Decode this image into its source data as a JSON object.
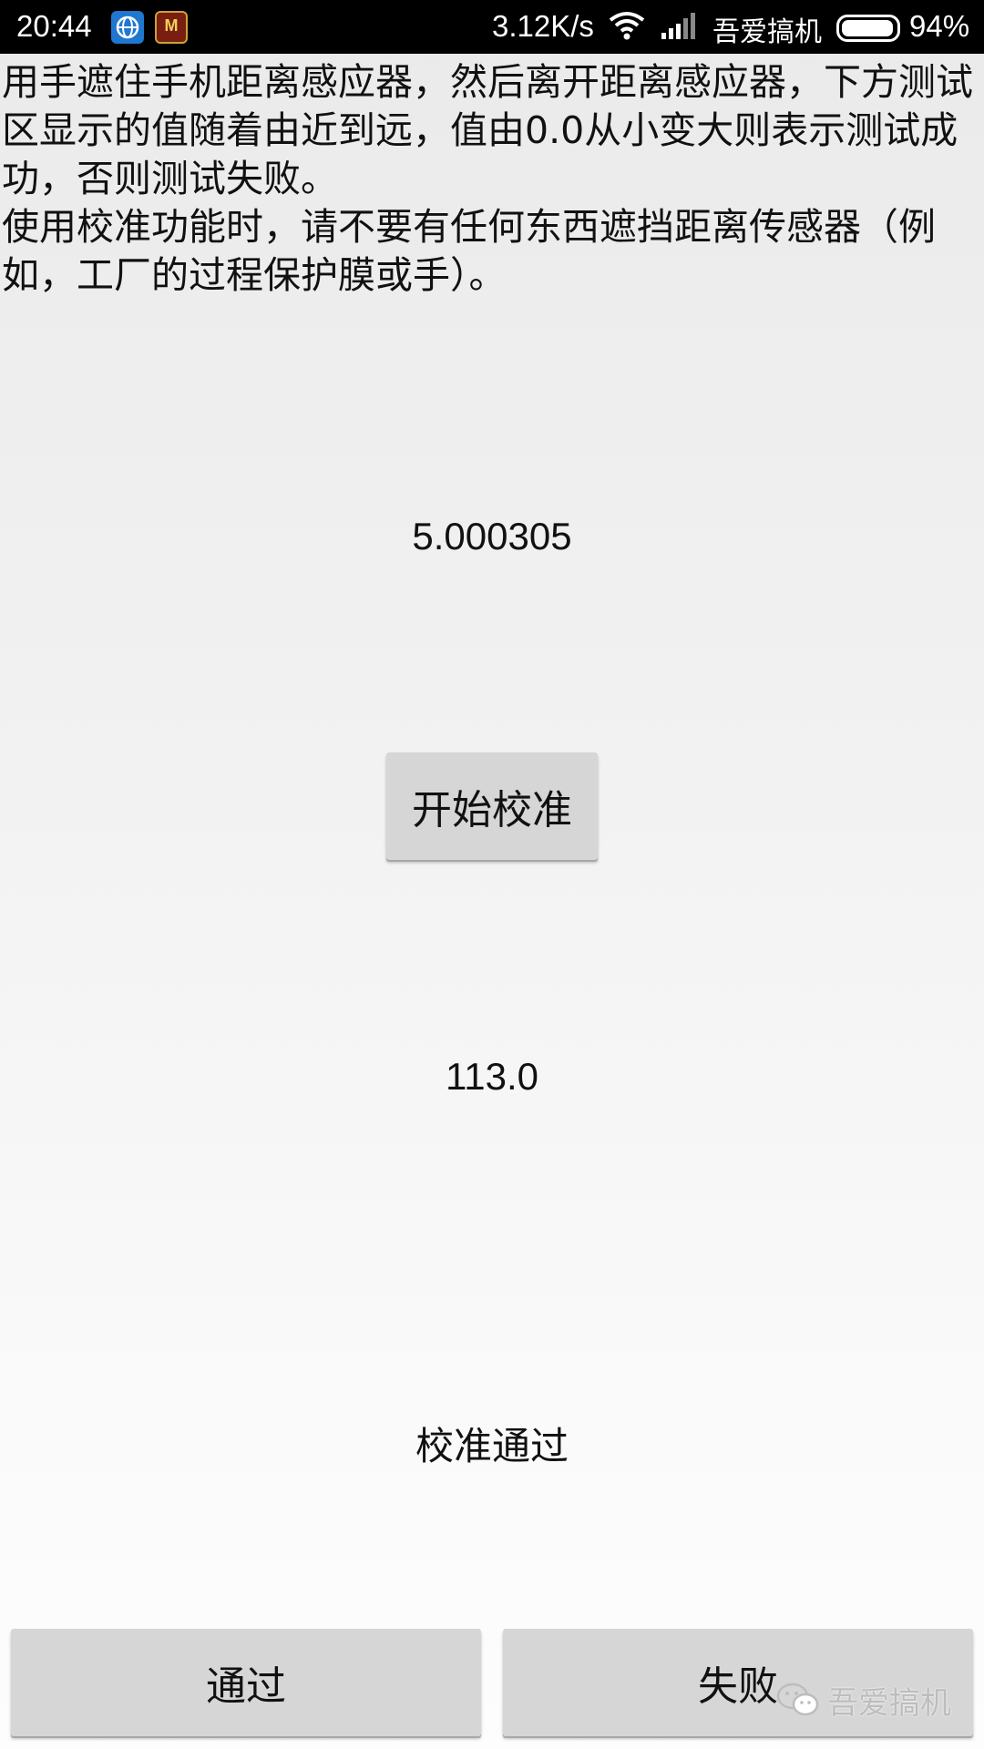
{
  "status_bar": {
    "time": "20:44",
    "net_speed": "3.12K/s",
    "carrier": "吾爱搞机",
    "battery": "94%",
    "icons": [
      "globe-app-icon",
      "game-app-icon",
      "wifi-icon",
      "signal-icon",
      "battery-icon"
    ]
  },
  "instructions": {
    "paragraph1": "用手遮住手机距离感应器，然后离开距离感应器，下方测试区显示的值随着由近到远，值由0.0从小变大则表示测试成功，否则测试失败。",
    "paragraph2": "使用校准功能时，请不要有任何东西遮挡距离传感器（例如，工厂的过程保护膜或手）。"
  },
  "sensor_value": "5.000305",
  "calibrate_button": "开始校准",
  "calibration_value": "113.0",
  "calibration_status": "校准通过",
  "buttons": {
    "pass": "通过",
    "fail": "失败"
  },
  "watermark": "吾爱搞机",
  "colors": {
    "status_bar_bg": "#000000",
    "button_bg": "#d6d6d6"
  }
}
